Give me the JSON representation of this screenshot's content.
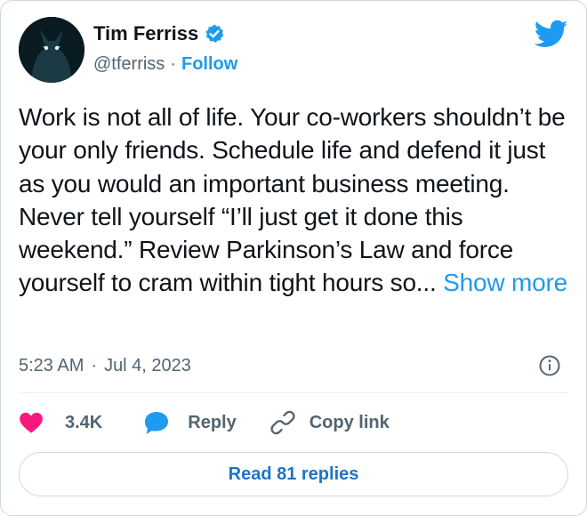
{
  "author": {
    "name": "Tim Ferriss",
    "handle": "@tferriss",
    "separator": "·",
    "follow_label": "Follow"
  },
  "tweet": {
    "text": "Work is not all of life. Your co-workers shouldn’t be your only friends. Schedule life and defend it just as you would an important business meeting. Never tell yourself “I’ll just get it done this weekend.” Review Parkinson’s Law and force yourself to cram within tight hours so...",
    "show_more_label": "Show more",
    "time": "5:23 AM",
    "separator": "·",
    "date": "Jul 4, 2023"
  },
  "actions": {
    "like_count": "3.4K",
    "reply_label": "Reply",
    "copy_link_label": "Copy link"
  },
  "footer": {
    "read_replies_label": "Read 81 replies"
  },
  "colors": {
    "accent": "#1d9bf0",
    "like": "#f91880",
    "text": "#0f1419",
    "muted": "#536471"
  },
  "icons": [
    "avatar-image",
    "verified-badge-icon",
    "twitter-bird-icon",
    "info-icon",
    "heart-icon",
    "reply-bubble-icon",
    "link-icon"
  ]
}
